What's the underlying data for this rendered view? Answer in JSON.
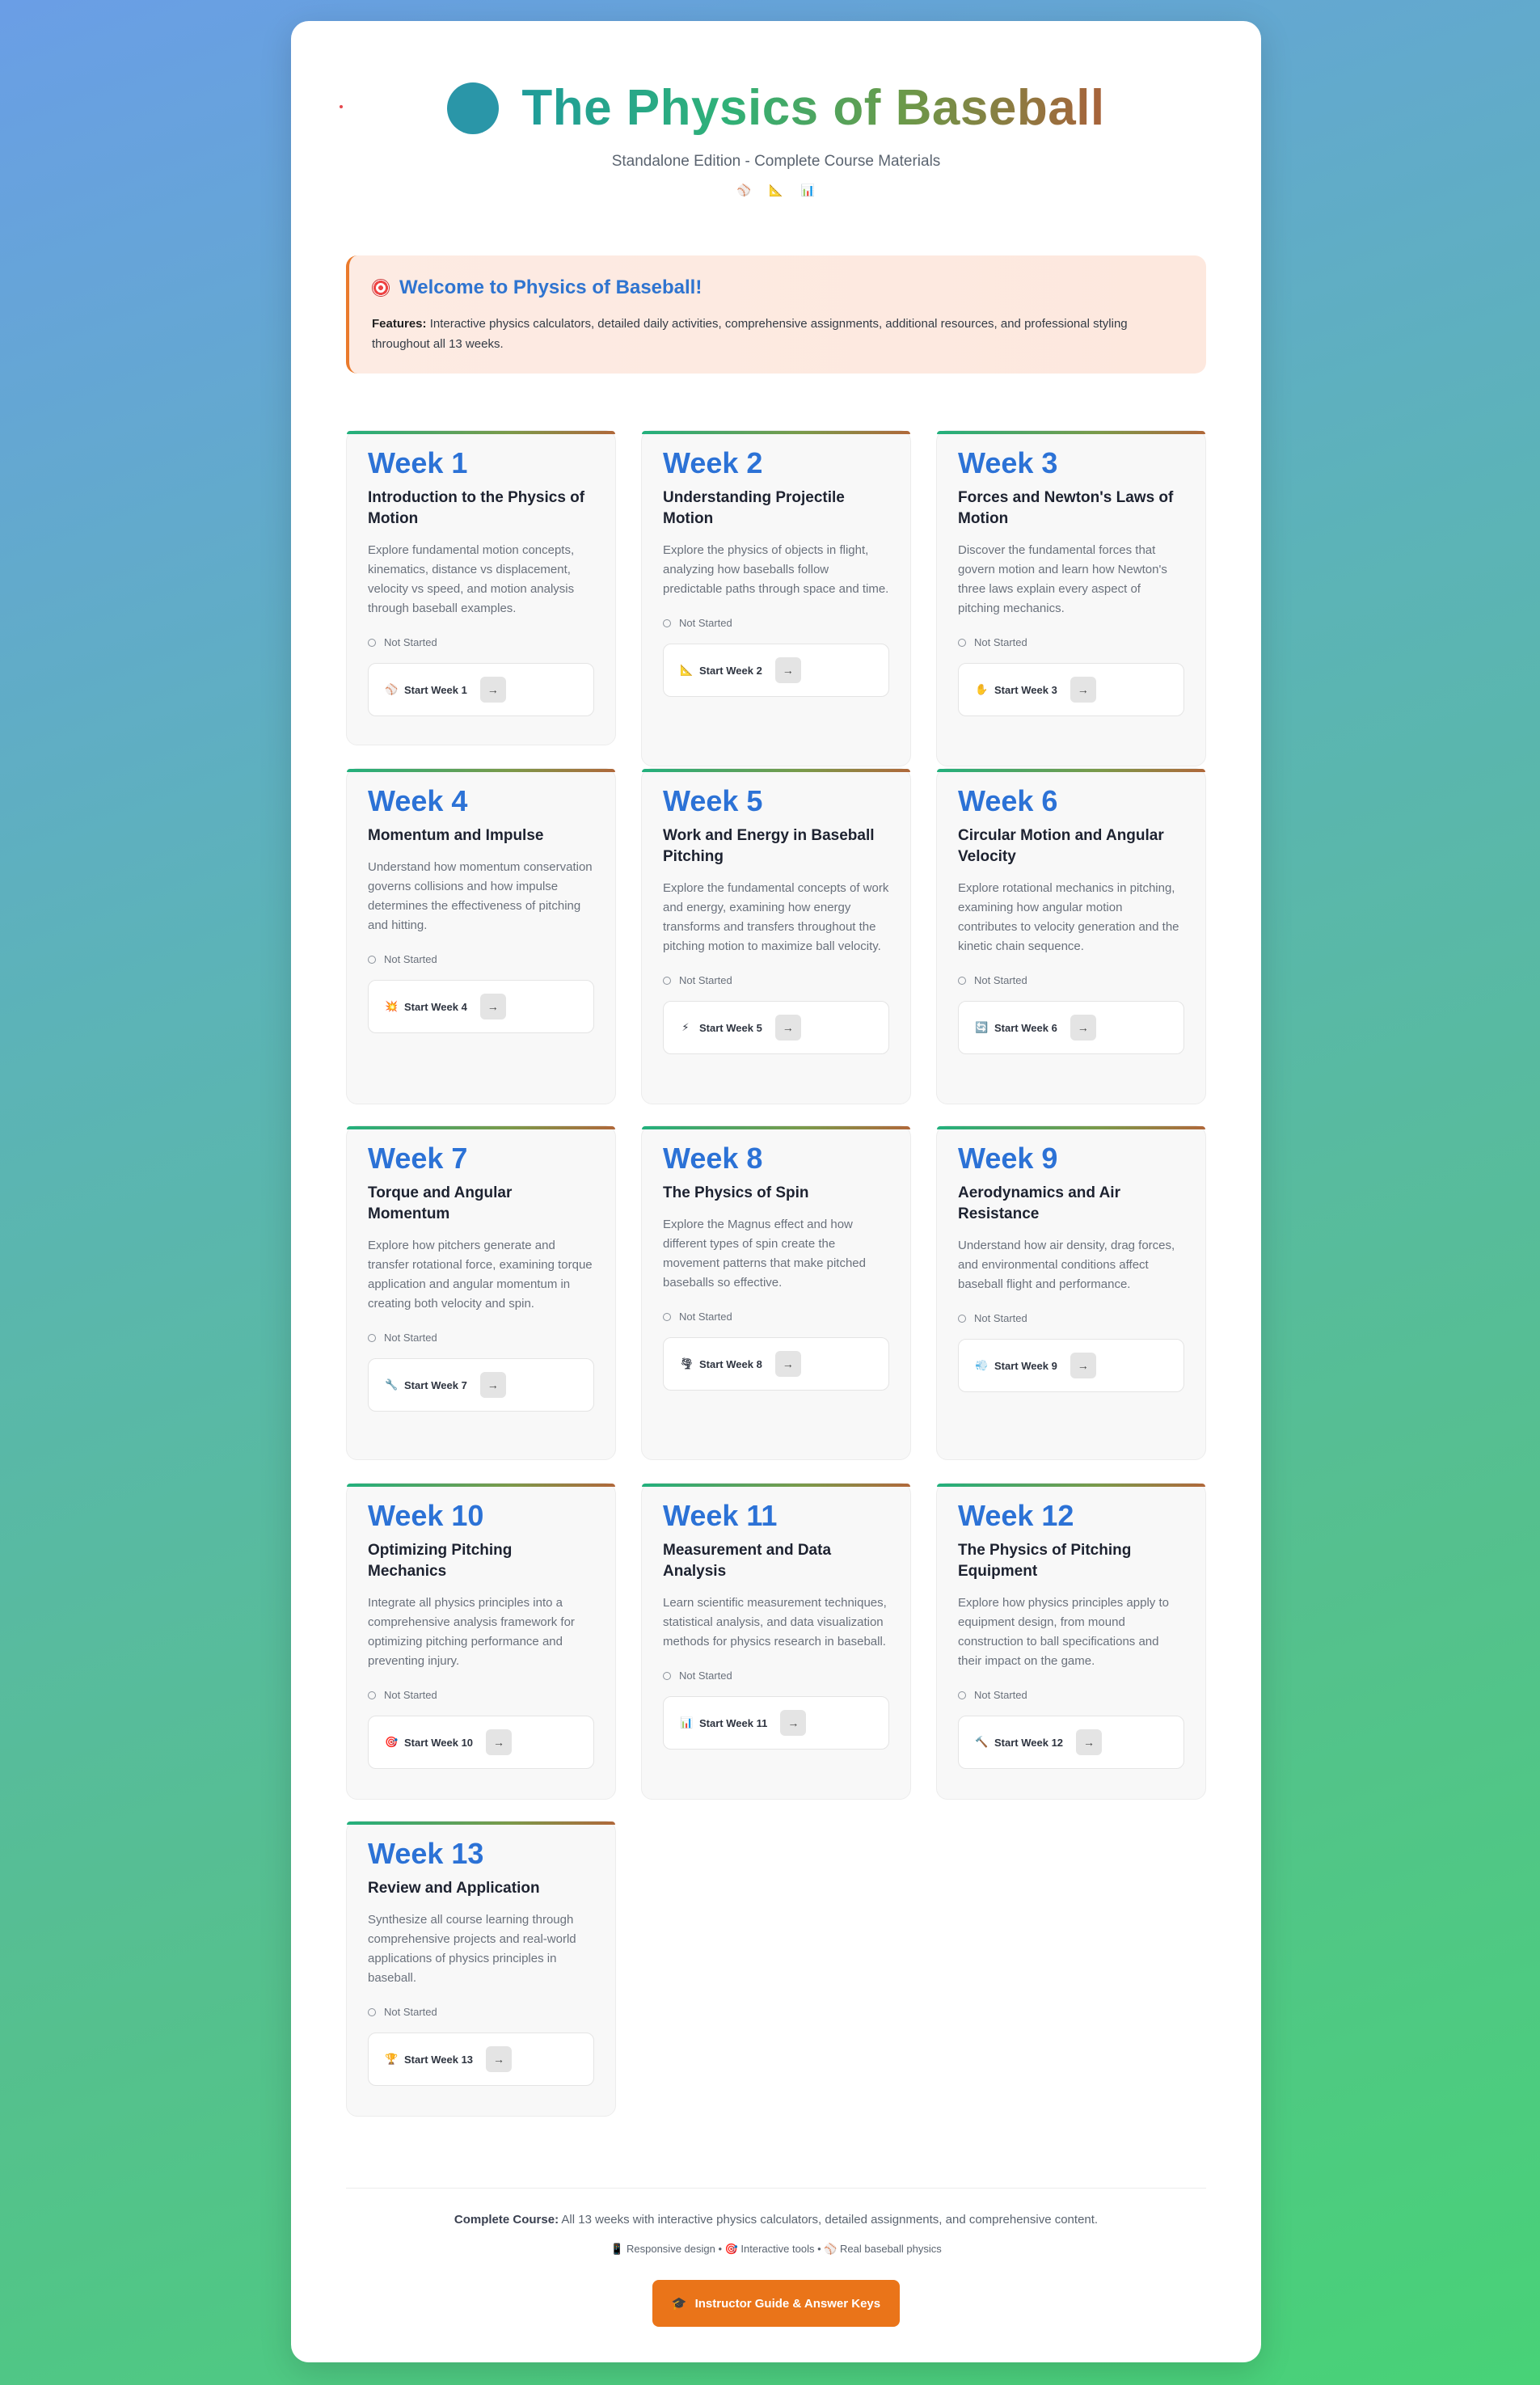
{
  "header": {
    "title": "The Physics of Baseball",
    "subtitle": "Standalone Edition - Complete Course Materials",
    "icons": [
      "⚾",
      "📐",
      "📊"
    ]
  },
  "welcome": {
    "title": "Welcome to Physics of Baseball!",
    "features_label": "Features:",
    "features_text": " Interactive physics calculators, detailed daily activities, comprehensive assignments, additional resources, and professional styling throughout all 13 weeks."
  },
  "weeks": [
    {
      "number": "Week 1",
      "title": "Introduction to the Physics of Motion",
      "description": "Explore fundamental motion concepts, kinematics, distance vs displacement, velocity vs speed, and motion analysis through baseball examples.",
      "status": "Not Started",
      "button": "Start Week 1",
      "icon": "⚾",
      "arrow": "→"
    },
    {
      "number": "Week 2",
      "title": "Understanding Projectile Motion",
      "description": "Explore the physics of objects in flight, analyzing how baseballs follow predictable paths through space and time.",
      "status": "Not Started",
      "button": "Start Week 2",
      "icon": "📐",
      "arrow": "→"
    },
    {
      "number": "Week 3",
      "title": "Forces and Newton's Laws of Motion",
      "description": "Discover the fundamental forces that govern motion and learn how Newton's three laws explain every aspect of pitching mechanics.",
      "status": "Not Started",
      "button": "Start Week 3",
      "icon": "✋",
      "arrow": "→"
    },
    {
      "number": "Week 4",
      "title": "Momentum and Impulse",
      "description": "Understand how momentum conservation governs collisions and how impulse determines the effectiveness of pitching and hitting.",
      "status": "Not Started",
      "button": "Start Week 4",
      "icon": "💥",
      "arrow": "→"
    },
    {
      "number": "Week 5",
      "title": "Work and Energy in Baseball Pitching",
      "description": "Explore the fundamental concepts of work and energy, examining how energy transforms and transfers throughout the pitching motion to maximize ball velocity.",
      "status": "Not Started",
      "button": "Start Week 5",
      "icon": "⚡",
      "arrow": "→"
    },
    {
      "number": "Week 6",
      "title": "Circular Motion and Angular Velocity",
      "description": "Explore rotational mechanics in pitching, examining how angular motion contributes to velocity generation and the kinetic chain sequence.",
      "status": "Not Started",
      "button": "Start Week 6",
      "icon": "🔄",
      "arrow": "→"
    },
    {
      "number": "Week 7",
      "title": "Torque and Angular Momentum",
      "description": "Explore how pitchers generate and transfer rotational force, examining torque application and angular momentum in creating both velocity and spin.",
      "status": "Not Started",
      "button": "Start Week 7",
      "icon": "🔧",
      "arrow": "→"
    },
    {
      "number": "Week 8",
      "title": "The Physics of Spin",
      "description": "Explore the Magnus effect and how different types of spin create the movement patterns that make pitched baseballs so effective.",
      "status": "Not Started",
      "button": "Start Week 8",
      "icon": "🌪",
      "arrow": "→"
    },
    {
      "number": "Week 9",
      "title": "Aerodynamics and Air Resistance",
      "description": "Understand how air density, drag forces, and environmental conditions affect baseball flight and performance.",
      "status": "Not Started",
      "button": "Start Week 9",
      "icon": "💨",
      "arrow": "→"
    },
    {
      "number": "Week 10",
      "title": "Optimizing Pitching Mechanics",
      "description": "Integrate all physics principles into a comprehensive analysis framework for optimizing pitching performance and preventing injury.",
      "status": "Not Started",
      "button": "Start Week 10",
      "icon": "🎯",
      "arrow": "→"
    },
    {
      "number": "Week 11",
      "title": "Measurement and Data Analysis",
      "description": "Learn scientific measurement techniques, statistical analysis, and data visualization methods for physics research in baseball.",
      "status": "Not Started",
      "button": "Start Week 11",
      "icon": "📊",
      "arrow": "→"
    },
    {
      "number": "Week 12",
      "title": "The Physics of Pitching Equipment",
      "description": "Explore how physics principles apply to equipment design, from mound construction to ball specifications and their impact on the game.",
      "status": "Not Started",
      "button": "Start Week 12",
      "icon": "🔨",
      "arrow": "→"
    },
    {
      "number": "Week 13",
      "title": "Review and Application",
      "description": "Synthesize all course learning through comprehensive projects and real-world applications of physics principles in baseball.",
      "status": "Not Started",
      "button": "Start Week 13",
      "icon": "🏆",
      "arrow": "→"
    }
  ],
  "footer": {
    "complete_label": "Complete Course:",
    "complete_text": " All 13 weeks with interactive physics calculators, detailed assignments, and comprehensive content.",
    "features": "📱 Responsive design • 🎯 Interactive tools • ⚾ Real baseball physics",
    "instructor_button": "Instructor Guide & Answer Keys",
    "instructor_icon": "🎓"
  }
}
